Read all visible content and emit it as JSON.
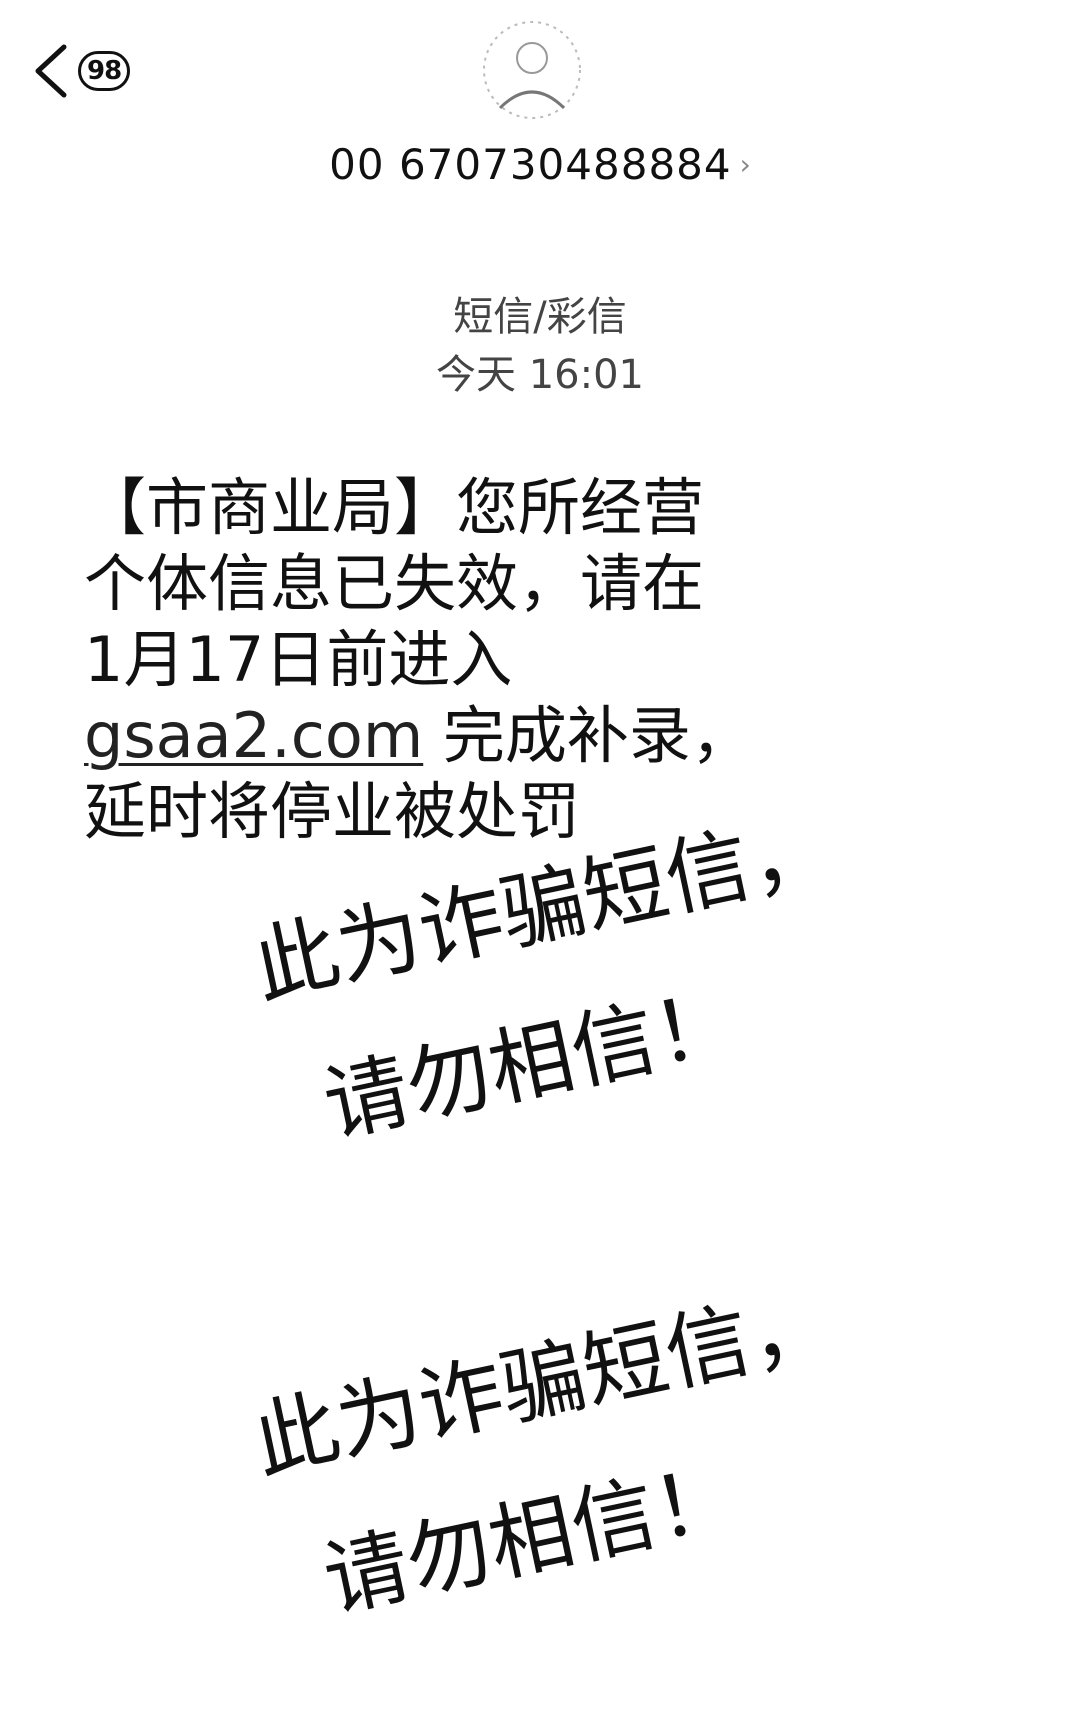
{
  "header": {
    "unread_count": "98",
    "contact_number": "00 670730488884",
    "contact_chevron": "›",
    "icons": [
      "back-chevron-icon",
      "avatar-icon",
      "chevron-right-icon"
    ]
  },
  "meta": {
    "type": "短信/彩信",
    "time": "今天 16:01"
  },
  "message": {
    "line1": "【市商业局】您所经营",
    "line2": "个体信息已失效，请在",
    "line3": "1月17日前进入",
    "link": "gsaa2.com",
    "line4_rest": " 完成补录，",
    "line5": "延时将停业被处罚"
  },
  "annotations": [
    {
      "line1": "此为诈骗短信，",
      "line2": "请勿相信！"
    },
    {
      "line1": "此为诈骗短信，",
      "line2": "请勿相信！"
    }
  ]
}
